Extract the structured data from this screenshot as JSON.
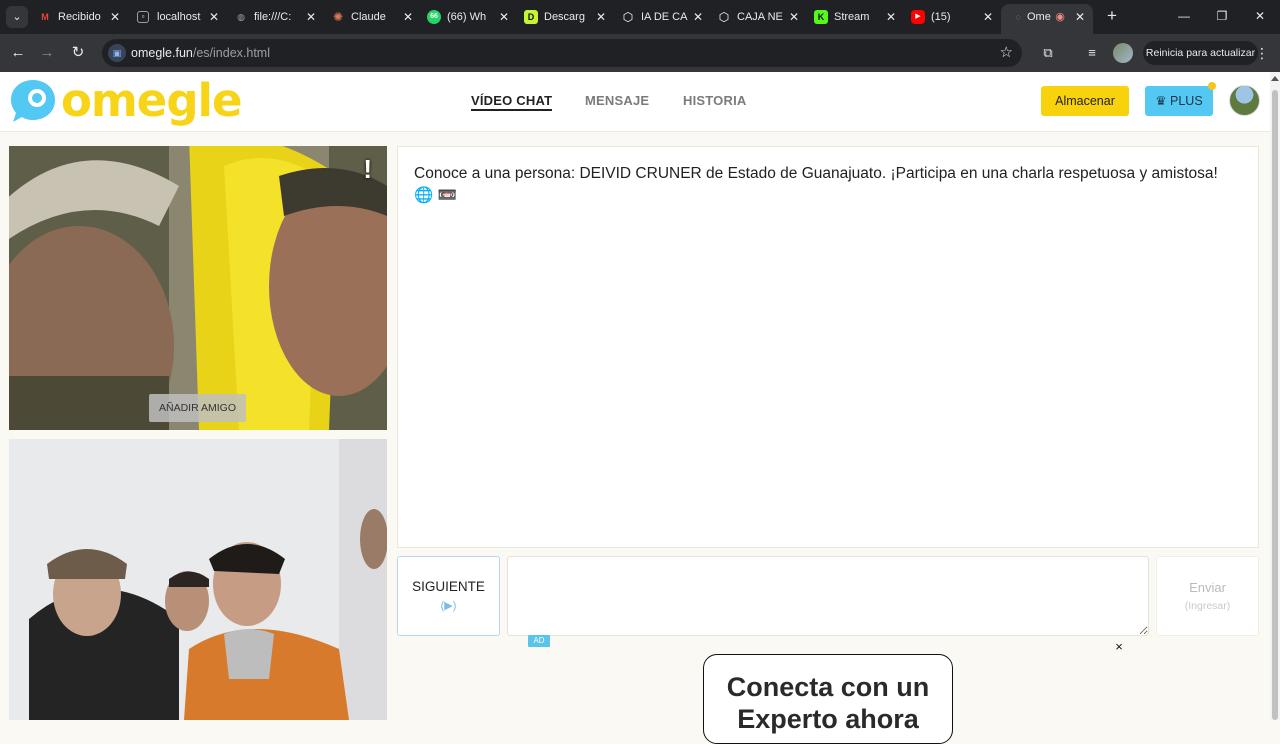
{
  "browser": {
    "tabs": [
      {
        "title": "Recibido",
        "icon": "gmail-icon",
        "color": "#ea4335"
      },
      {
        "title": "localhost",
        "icon": "localhost-icon",
        "color": "#9aa0a6"
      },
      {
        "title": "file:///C:",
        "icon": "globe-icon",
        "color": "#9aa0a6"
      },
      {
        "title": "Claude",
        "icon": "claude-icon",
        "color": "#d97757"
      },
      {
        "title": "(66) Wh",
        "icon": "whatsapp-icon",
        "color": "#25d366"
      },
      {
        "title": "Descarg",
        "icon": "d-icon",
        "color": "#c6f432"
      },
      {
        "title": "IA DE CA",
        "icon": "openai-icon",
        "color": "#ffffff"
      },
      {
        "title": "CAJA NE",
        "icon": "openai-icon",
        "color": "#ffffff"
      },
      {
        "title": "Stream",
        "icon": "kick-icon",
        "color": "#53fc18"
      },
      {
        "title": "(15)",
        "icon": "youtube-icon",
        "color": "#ff0000"
      },
      {
        "title": "Ome",
        "icon": "omegle-icon",
        "color": "#5f6368",
        "active": true
      }
    ],
    "url_host": "omegle.fun",
    "url_path": "/es/index.html",
    "update_label": "Reinicia para actualizar"
  },
  "site": {
    "logo_text": "omegle",
    "nav": [
      {
        "label": "VÍDEO CHAT",
        "active": true
      },
      {
        "label": "MENSAJE",
        "active": false
      },
      {
        "label": "HISTORIA",
        "active": false
      }
    ],
    "store_label": "Almacenar",
    "plus_label": "PLUS",
    "plus_icon": "crown-icon"
  },
  "video": {
    "report_label": "!",
    "add_friend_label": "AÑADIR AMIGO"
  },
  "chat": {
    "message": "Conoce a una persona: DEIVID CRUNER de Estado de Guanajuato. ¡Participa en una charla respetuosa y amistosa! 🌐 📼",
    "next_label": "SIGUIENTE",
    "next_hint": "(▶)",
    "input_placeholder": "",
    "send_label": "Enviar",
    "send_hint": "(Ingresar)"
  },
  "ad": {
    "badge": "AD",
    "close": "×",
    "headline": "Conecta con un Experto ahora"
  },
  "colors": {
    "brand_yellow": "#f7d418",
    "brand_blue": "#52c8f2",
    "store_yellow": "#f8d20c"
  }
}
